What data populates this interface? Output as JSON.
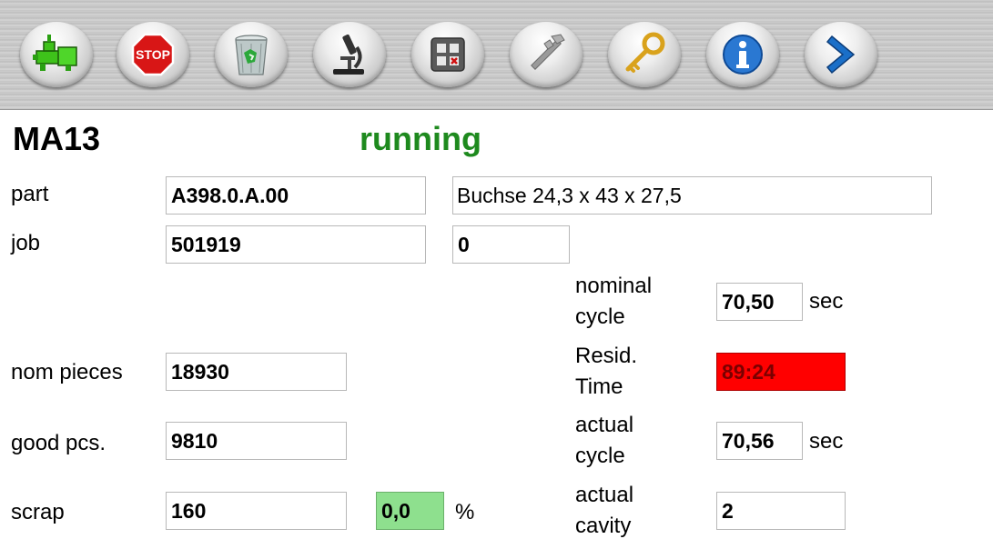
{
  "toolbar": {
    "buttons": [
      {
        "name": "machine-icon"
      },
      {
        "name": "stop-icon"
      },
      {
        "name": "trash-icon"
      },
      {
        "name": "microscope-icon"
      },
      {
        "name": "control-panel-icon"
      },
      {
        "name": "caliper-icon"
      },
      {
        "name": "key-icon"
      },
      {
        "name": "info-icon"
      },
      {
        "name": "forward-arrow-icon"
      }
    ]
  },
  "header": {
    "machine": "MA13",
    "status": "running",
    "status_color": "#1e8a1e"
  },
  "part": {
    "label": "part",
    "number": "A398.0.A.00",
    "description": "Buchse 24,3 x 43 x 27,5"
  },
  "job": {
    "label": "job",
    "number": "501919",
    "extra": "0"
  },
  "nominal_cycle": {
    "label_line1": "nominal",
    "label_line2": "cycle",
    "value": "70,50",
    "unit": "sec"
  },
  "nom_pieces": {
    "label": "nom pieces",
    "value": "18930"
  },
  "resid_time": {
    "label_line1": "Resid.",
    "label_line2": "Time",
    "value": "89:24",
    "color": "#ff0000"
  },
  "good_pcs": {
    "label": "good pcs.",
    "value": "9810"
  },
  "actual_cycle": {
    "label_line1": "actual",
    "label_line2": "cycle",
    "value": "70,56",
    "unit": "sec"
  },
  "scrap": {
    "label": "scrap",
    "value": "160",
    "percent": "0,0",
    "percent_unit": "%",
    "percent_color": "#8ee08e"
  },
  "actual_cavity": {
    "label_line1": "actual",
    "label_line2": "cavity",
    "value": "2"
  }
}
